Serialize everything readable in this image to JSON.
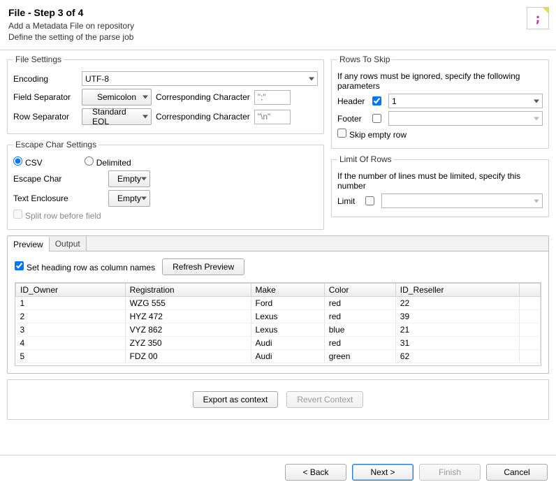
{
  "header": {
    "title": "File - Step 3 of 4",
    "subtitle_line1": "Add a Metadata File on repository",
    "subtitle_line2": "Define the setting of the parse job"
  },
  "fileSettings": {
    "legend": "File Settings",
    "encoding_label": "Encoding",
    "encoding_value": "UTF-8",
    "fieldsep_label": "Field Separator",
    "fieldsep_value": "Semicolon",
    "fieldsep_char_label": "Corresponding Character",
    "fieldsep_char_value": "\";\"",
    "rowsep_label": "Row Separator",
    "rowsep_value": "Standard EOL",
    "rowsep_char_label": "Corresponding Character",
    "rowsep_char_value": "\"\\n\""
  },
  "escape": {
    "legend": "Escape Char Settings",
    "csv_label": "CSV",
    "delimited_label": "Delimited",
    "escape_char_label": "Escape Char",
    "escape_char_value": "Empty",
    "text_enclosure_label": "Text Enclosure",
    "text_enclosure_value": "Empty",
    "split_label": "Split row before field"
  },
  "rowsToSkip": {
    "legend": "Rows To Skip",
    "hint": "If any rows must be ignored, specify the following parameters",
    "header_label": "Header",
    "header_value": "1",
    "footer_label": "Footer",
    "footer_value": "",
    "skip_empty_label": "Skip empty row"
  },
  "limit": {
    "legend": "Limit Of Rows",
    "hint": "If the number of lines must be limited, specify this number",
    "limit_label": "Limit",
    "limit_value": ""
  },
  "tabs": {
    "preview": "Preview",
    "output": "Output",
    "heading_check_label": "Set heading row as column names",
    "refresh_label": "Refresh Preview"
  },
  "table": {
    "columns": [
      "ID_Owner",
      "Registration",
      "Make",
      "Color",
      "ID_Reseller"
    ],
    "rows": [
      [
        "1",
        "WZG 555",
        "Ford",
        "red",
        "22"
      ],
      [
        "2",
        "HYZ 472",
        "Lexus",
        "red",
        "39"
      ],
      [
        "3",
        "VYZ 862",
        "Lexus",
        "blue",
        "21"
      ],
      [
        "4",
        "ZYZ 350",
        "Audi",
        "red",
        "31"
      ],
      [
        "5",
        "FDZ 00",
        "Audi",
        "green",
        "62"
      ]
    ]
  },
  "actions": {
    "export": "Export as context",
    "revert": "Revert Context"
  },
  "footer": {
    "back": "< Back",
    "next": "Next >",
    "finish": "Finish",
    "cancel": "Cancel"
  }
}
